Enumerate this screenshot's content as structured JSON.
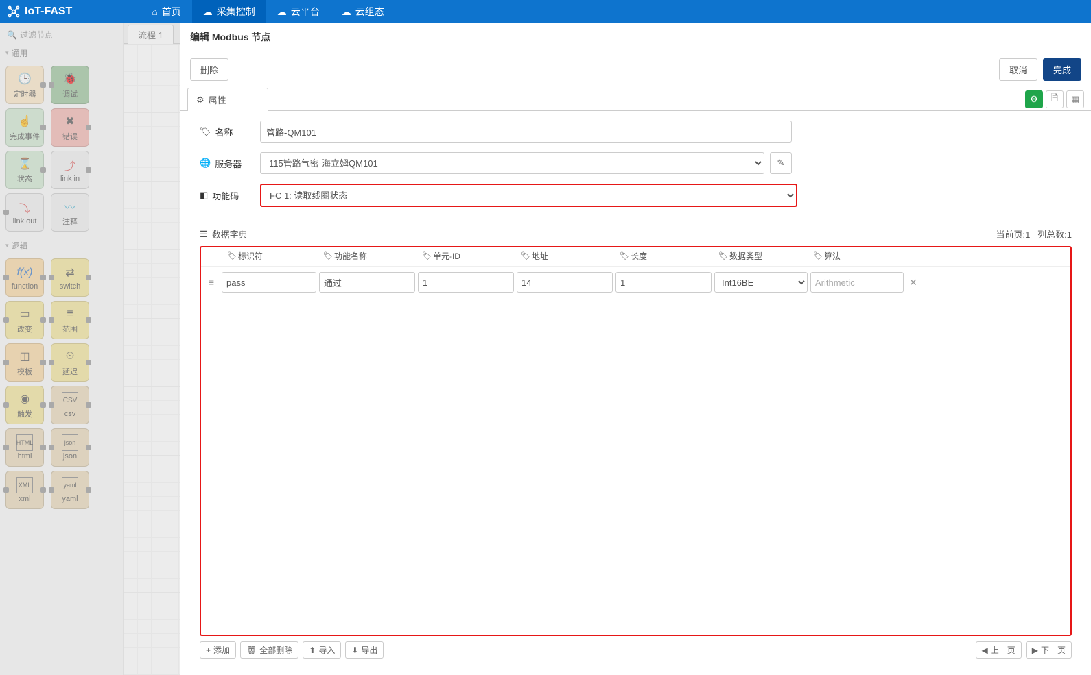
{
  "brand": "IoT-FAST",
  "topnav": {
    "home": "首页",
    "collect": "采集控制",
    "cloud": "云平台",
    "cloudcfg": "云组态"
  },
  "palette": {
    "search_placeholder": "过滤节点",
    "cat_common": "通用",
    "cat_logic": "逻辑",
    "nodes": {
      "timer": "定时器",
      "debug": "调试",
      "complete": "完成事件",
      "error": "错误",
      "status": "状态",
      "linkin": "link in",
      "linkout": "link out",
      "comment": "注释",
      "function": "function",
      "switch": "switch",
      "change": "改变",
      "range": "范围",
      "template": "模板",
      "delay": "延迟",
      "trigger": "触发",
      "csv": "csv",
      "html": "html",
      "json": "json",
      "xml": "xml",
      "yaml": "yaml"
    }
  },
  "canvas": {
    "tab": "流程 1"
  },
  "editor": {
    "title": "编辑 Modbus 节点",
    "btn_delete": "删除",
    "btn_cancel": "取消",
    "btn_done": "完成",
    "tab_property": "属性",
    "labels": {
      "name": "名称",
      "server": "服务器",
      "funcCode": "功能码",
      "dict": "数据字典"
    },
    "values": {
      "name": "管路-QM101",
      "server": "115管路气密-海立姆QM101",
      "funcCode": "FC 1: 读取线圈状态"
    },
    "pageinfo": {
      "curpage_label": "当前页:",
      "curpage_val": "1",
      "colcount_label": "列总数:",
      "colcount_val": "1"
    },
    "columns": {
      "id": "标识符",
      "fn": "功能名称",
      "uid": "单元-ID",
      "addr": "地址",
      "len": "长度",
      "dt": "数据类型",
      "alg": "算法"
    },
    "row": {
      "id": "pass",
      "fn": "通过",
      "uid": "1",
      "addr": "14",
      "len": "1",
      "dt": "Int16BE",
      "alg_placeholder": "Arithmetic"
    },
    "footer": {
      "add": "添加",
      "delall": "全部删除",
      "import": "导入",
      "export": "导出",
      "prev": "上一页",
      "next": "下一页"
    }
  }
}
